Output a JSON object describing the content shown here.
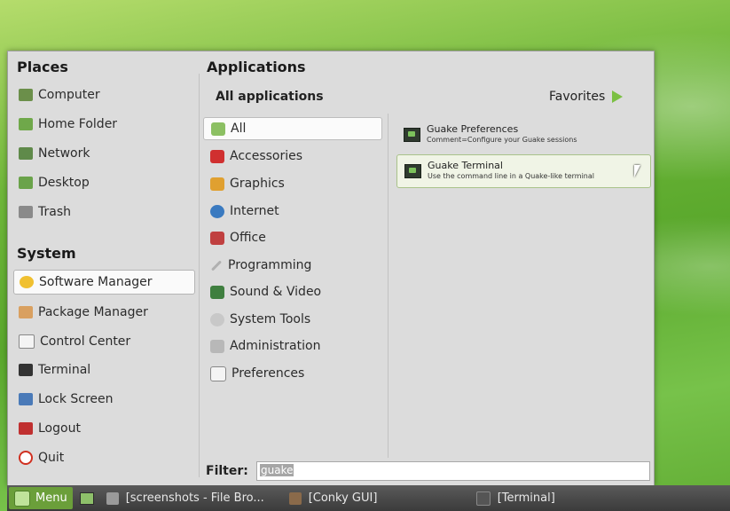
{
  "places": {
    "title": "Places",
    "items": [
      {
        "label": "Computer",
        "icon": "computer-icon",
        "color": "#6b8f4a"
      },
      {
        "label": "Home Folder",
        "icon": "home-folder-icon",
        "color": "#6fa84a"
      },
      {
        "label": "Network",
        "icon": "network-icon",
        "color": "#5f8a4a"
      },
      {
        "label": "Desktop",
        "icon": "desktop-icon",
        "color": "#6aa34a"
      },
      {
        "label": "Trash",
        "icon": "trash-icon",
        "color": "#8a8a8a"
      }
    ]
  },
  "system": {
    "title": "System",
    "items": [
      {
        "label": "Software Manager",
        "icon": "star-icon",
        "color": "#f0c030"
      },
      {
        "label": "Package Manager",
        "icon": "package-icon",
        "color": "#d9a060"
      },
      {
        "label": "Control Center",
        "icon": "control-center-icon",
        "color": "#9a9a9a"
      },
      {
        "label": "Terminal",
        "icon": "terminal-icon",
        "color": "#333333"
      },
      {
        "label": "Lock Screen",
        "icon": "lock-icon",
        "color": "#4a7ab8"
      },
      {
        "label": "Logout",
        "icon": "logout-icon",
        "color": "#c03030"
      },
      {
        "label": "Quit",
        "icon": "power-icon",
        "color": "#d03020"
      }
    ]
  },
  "applications": {
    "title": "Applications",
    "all_label": "All applications",
    "favorites_label": "Favorites",
    "categories": [
      {
        "label": "All",
        "icon": "all-icon",
        "color": "#8cc063"
      },
      {
        "label": "Accessories",
        "icon": "accessories-icon",
        "color": "#d03030"
      },
      {
        "label": "Graphics",
        "icon": "graphics-icon",
        "color": "#e0a030"
      },
      {
        "label": "Internet",
        "icon": "internet-icon",
        "color": "#3a7ac0"
      },
      {
        "label": "Office",
        "icon": "office-icon",
        "color": "#c04040"
      },
      {
        "label": "Programming",
        "icon": "programming-icon",
        "color": "#b0b0b0"
      },
      {
        "label": "Sound & Video",
        "icon": "sound-video-icon",
        "color": "#3f7f3f"
      },
      {
        "label": "System Tools",
        "icon": "system-tools-icon",
        "color": "#c8c8c8"
      },
      {
        "label": "Administration",
        "icon": "administration-icon",
        "color": "#b8b8b8"
      },
      {
        "label": "Preferences",
        "icon": "preferences-icon",
        "color": "#a0a0a0"
      }
    ],
    "apps": [
      {
        "name": "Guake Preferences",
        "description": "Comment=Configure your Guake sessions"
      },
      {
        "name": "Guake Terminal",
        "description": "Use the command line in a Quake-like terminal"
      }
    ]
  },
  "filter": {
    "label": "Filter:",
    "value": "guake"
  },
  "taskbar": {
    "menu_label": "Menu",
    "tasks": [
      {
        "label": "[screenshots - File Bro...",
        "icon": "file-browser-icon"
      },
      {
        "label": "[Conky GUI]",
        "icon": "conky-icon"
      },
      {
        "label": "[Terminal]",
        "icon": "terminal-icon"
      }
    ]
  }
}
